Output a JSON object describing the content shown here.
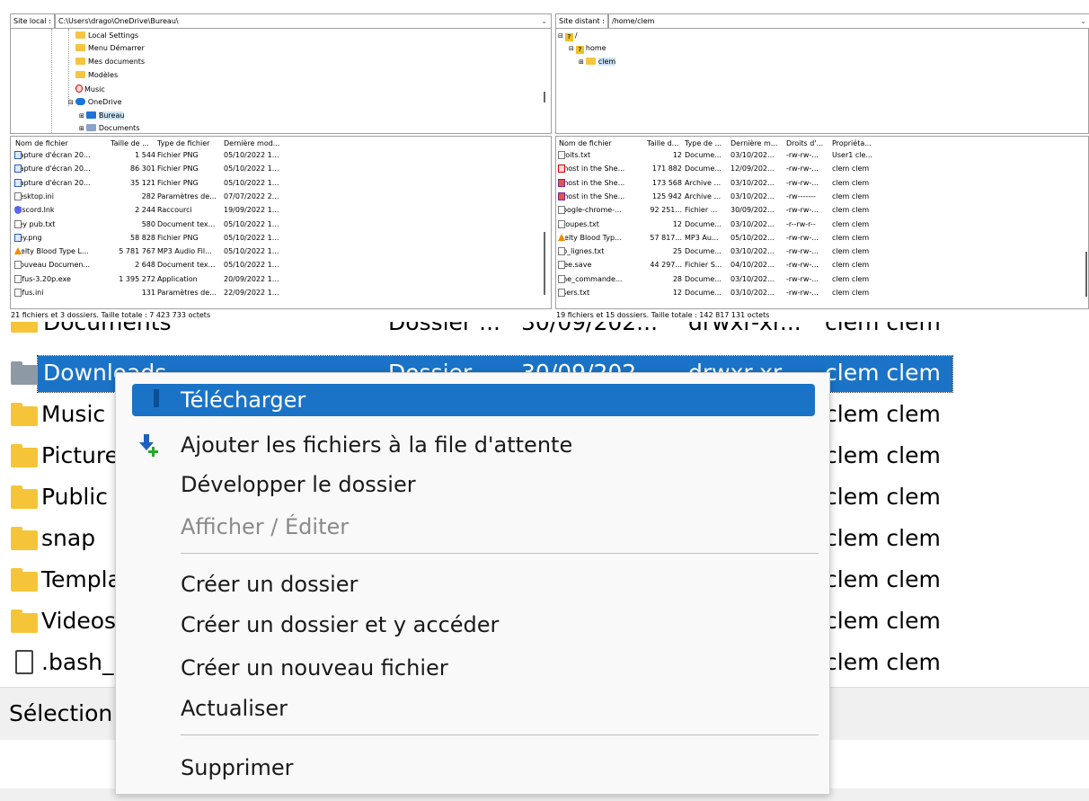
{
  "local": {
    "site_label": "Site local :",
    "path": "C:\\Users\\drago\\OneDrive\\Bureau\\",
    "tree": [
      "Local Settings",
      "Menu Démarrer",
      "Mes documents",
      "Modèles",
      "Music",
      "OneDrive",
      "Bureau",
      "Documents"
    ],
    "columns": [
      "Nom de fichier",
      "Taille de ...",
      "Type de fichier",
      "Dernière mod..."
    ],
    "files": [
      {
        "name": "Capture d'écran 20...",
        "size": "1 544",
        "type": "Fichier PNG",
        "date": "05/10/2022 1..."
      },
      {
        "name": "Capture d'écran 20...",
        "size": "86 301",
        "type": "Fichier PNG",
        "date": "05/10/2022 1..."
      },
      {
        "name": "Capture d'écran 20...",
        "size": "35 121",
        "type": "Fichier PNG",
        "date": "05/10/2022 1..."
      },
      {
        "name": "desktop.ini",
        "size": "282",
        "type": "Paramètres de...",
        "date": "07/07/2022 2..."
      },
      {
        "name": "Discord.lnk",
        "size": "2 244",
        "type": "Raccourci",
        "date": "19/09/2022 1..."
      },
      {
        "name": "key pub.txt",
        "size": "580",
        "type": "Document tex...",
        "date": "05/10/2022 1..."
      },
      {
        "name": "key.png",
        "size": "58 828",
        "type": "Fichier PNG",
        "date": "05/10/2022 1..."
      },
      {
        "name": "Melty Blood Type L...",
        "size": "5 781 767",
        "type": "MP3 Audio Fil...",
        "date": "05/10/2022 1..."
      },
      {
        "name": "Nouveau Documen...",
        "size": "2 648",
        "type": "Document tex...",
        "date": "05/10/2022 1..."
      },
      {
        "name": "rufus-3.20p.exe",
        "size": "1 395 272",
        "type": "Application",
        "date": "20/09/2022 1..."
      },
      {
        "name": "rufus.ini",
        "size": "131",
        "type": "Paramètres de...",
        "date": "22/09/2022 1..."
      }
    ],
    "status": "21 fichiers et 3 dossiers. Taille totale : 7 423 733 octets"
  },
  "remote": {
    "site_label": "Site distant :",
    "path": "/home/clem",
    "tree": [
      "/",
      "home",
      "clem"
    ],
    "columns": [
      "Nom de fichier",
      "Taille d...",
      "Type de ...",
      "Dernière m...",
      "Droits d'...",
      "Propriéta..."
    ],
    "files": [
      {
        "name": "droits.txt",
        "size": "12",
        "type": "Docume...",
        "date": "03/10/202...",
        "perm": "-rw-rw-...",
        "owner": "User1 cle..."
      },
      {
        "name": "Ghost in the She...",
        "size": "171 882",
        "type": "Docume...",
        "date": "12/09/202...",
        "perm": "-rw-rw-...",
        "owner": "clem clem"
      },
      {
        "name": "Ghost in the She...",
        "size": "173 568",
        "type": "Archive ...",
        "date": "03/10/202...",
        "perm": "-rw-rw-...",
        "owner": "clem clem"
      },
      {
        "name": "Ghost in the She...",
        "size": "125 942",
        "type": "Archive ...",
        "date": "03/10/202...",
        "perm": "-rw-------",
        "owner": "clem clem"
      },
      {
        "name": "google-chrome-...",
        "size": "92 251...",
        "type": "Fichier ...",
        "date": "30/09/202...",
        "perm": "-rw-rw-...",
        "owner": "clem clem"
      },
      {
        "name": "groupes.txt",
        "size": "12",
        "type": "Docume...",
        "date": "03/10/202...",
        "perm": "-r--rw-r--",
        "owner": "clem clem"
      },
      {
        "name": "Melty Blood Typ...",
        "size": "57 817...",
        "type": "MP3 Au...",
        "date": "05/10/202...",
        "perm": "-rw-rw-...",
        "owner": "clem clem"
      },
      {
        "name": "nb_lignes.txt",
        "size": "25",
        "type": "Docume...",
        "date": "03/10/202...",
        "perm": "-rw-rw-...",
        "owner": "clem clem"
      },
      {
        "name": "tree.save",
        "size": "44 297...",
        "type": "Fichier S...",
        "date": "04/10/202...",
        "perm": "-rw-rw-...",
        "owner": "clem clem"
      },
      {
        "name": "une_commande...",
        "size": "28",
        "type": "Docume...",
        "date": "03/10/202...",
        "perm": "-rw-rw-...",
        "owner": "clem clem"
      },
      {
        "name": "users.txt",
        "size": "12",
        "type": "Docume...",
        "date": "03/10/202...",
        "perm": "-rw-rw-...",
        "owner": "clem clem"
      }
    ],
    "status": "19 fichiers et 15 dossiers. Taille totale : 142 817 131 octets"
  },
  "zoomed": {
    "partial_top": "Documents",
    "partial_top_type": "Dossier ...",
    "partial_top_date": "30/09/202...",
    "partial_top_perm": "drwxr-xr...",
    "partial_top_owner": "clem clem",
    "rows": [
      {
        "name": "Downloads",
        "type": "Dossier",
        "date": "30/09/202...",
        "perm": "drwxr-xr...",
        "owner": "clem clem"
      },
      {
        "name": "Music",
        "owner": "clem clem"
      },
      {
        "name": "Pictures",
        "owner": "clem clem"
      },
      {
        "name": "Public",
        "owner": "clem clem"
      },
      {
        "name": "snap",
        "owner": "clem clem"
      },
      {
        "name": "Templates",
        "owner": "clem clem"
      },
      {
        "name": "Videos",
        "owner": "clem clem"
      },
      {
        "name": ".bash_",
        "owner": "clem clem"
      }
    ],
    "selection_label": "Sélection"
  },
  "context_menu": {
    "items": [
      {
        "label": "Télécharger",
        "state": "selected"
      },
      {
        "label": "Ajouter les fichiers à la file d'attente",
        "state": "normal"
      },
      {
        "label": "Développer le dossier",
        "state": "normal"
      },
      {
        "label": "Afficher / Éditer",
        "state": "disabled"
      },
      {
        "label": "Créer un dossier",
        "state": "normal"
      },
      {
        "label": "Créer un dossier et y accéder",
        "state": "normal"
      },
      {
        "label": "Créer un nouveau fichier",
        "state": "normal"
      },
      {
        "label": "Actualiser",
        "state": "normal"
      },
      {
        "label": "Supprimer",
        "state": "normal"
      }
    ]
  },
  "colors": {
    "selection": "#1a73c6",
    "folder": "#f6c438",
    "row_highlight": "#cce4f7"
  }
}
